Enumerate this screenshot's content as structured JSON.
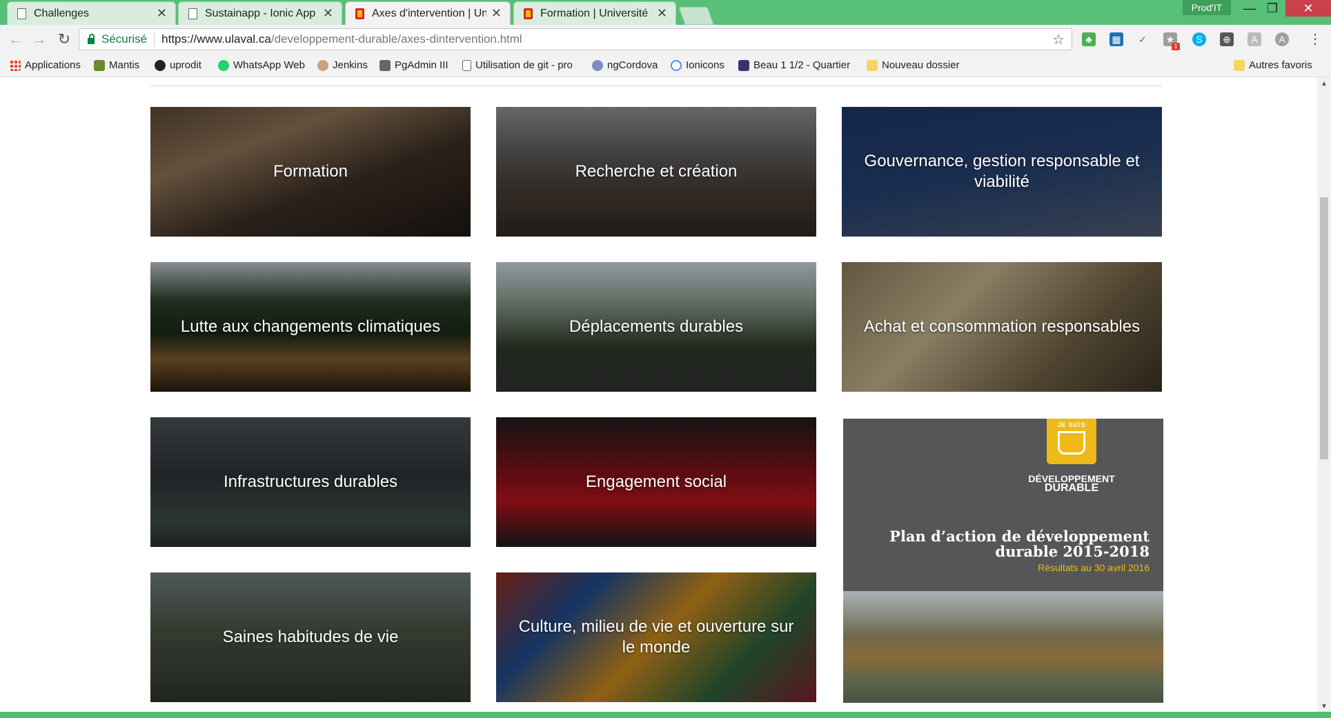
{
  "browser": {
    "tabs": [
      {
        "label": "Challenges",
        "icon": "document-icon",
        "active": false
      },
      {
        "label": "Sustainapp - Ionic App",
        "icon": "document-icon",
        "active": false
      },
      {
        "label": "Axes d'intervention | Uni",
        "icon": "ulaval-icon",
        "active": true
      },
      {
        "label": "Formation | Université La",
        "icon": "ulaval-icon",
        "active": false
      }
    ],
    "profile": "Prod'IT",
    "security_label": "Sécurisé",
    "url_host": "https://www.ulaval.ca",
    "url_path": "/developpement-durable/axes-dintervention.html",
    "extension_badge": "1"
  },
  "bookmarks": [
    {
      "label": "Applications",
      "icon": "apps-grid-icon"
    },
    {
      "label": "Mantis",
      "icon": "mantis-icon"
    },
    {
      "label": "uprodit",
      "icon": "uprodit-icon"
    },
    {
      "label": "WhatsApp Web",
      "icon": "whatsapp-icon"
    },
    {
      "label": "Jenkins",
      "icon": "jenkins-icon"
    },
    {
      "label": "PgAdmin III",
      "icon": "pgadmin-icon"
    },
    {
      "label": "Utilisation de git - pro",
      "icon": "document-icon"
    },
    {
      "label": "ngCordova",
      "icon": "ngcordova-icon"
    },
    {
      "label": "Ionicons",
      "icon": "ionicons-icon"
    },
    {
      "label": "Beau 1 1/2 - Quartier",
      "icon": "kijiji-icon"
    },
    {
      "label": "Nouveau dossier",
      "icon": "folder-icon"
    },
    {
      "label": "Autres favoris",
      "icon": "folder-icon"
    }
  ],
  "cards": [
    {
      "title": "Formation"
    },
    {
      "title": "Recherche et création"
    },
    {
      "title": "Gouvernance, gestion responsable et viabilité"
    },
    {
      "title": "Lutte aux changements climatiques"
    },
    {
      "title": "Déplacements durables"
    },
    {
      "title": "Achat et consommation responsables"
    },
    {
      "title": "Infrastructures durables"
    },
    {
      "title": "Engagement social"
    },
    {
      "title": "Saines habitudes de vie"
    },
    {
      "title": "Culture, milieu de vie et ouverture sur le monde"
    }
  ],
  "plan": {
    "logo_top": "JE SUIS",
    "logo_sub_1": "DÉVELOPPEMENT",
    "logo_sub_2": "DURABLE",
    "title_line1": "Plan d’action de développement",
    "title_line2": "durable 2015-2018",
    "subtitle": "Résultats au 30 avril 2016"
  }
}
